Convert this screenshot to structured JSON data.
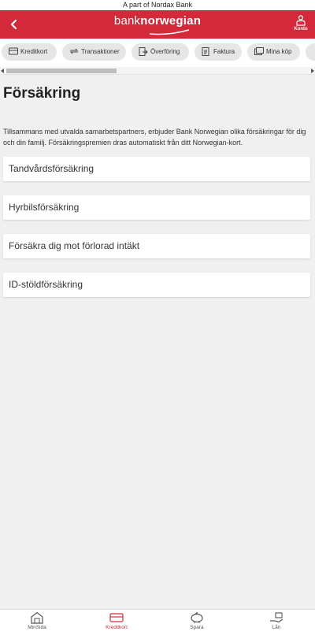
{
  "topbar": {
    "text": "A part of Nordax Bank"
  },
  "header": {
    "logo_light": "bank",
    "logo_bold": "norwegian",
    "account_label": "Konto"
  },
  "tabs": [
    {
      "label": "Kreditkort"
    },
    {
      "label": "Transaktioner"
    },
    {
      "label": "Överföring"
    },
    {
      "label": "Faktura"
    },
    {
      "label": "Mina köp"
    }
  ],
  "page": {
    "title": "Försäkring",
    "intro": "Tillsammans med utvalda samarbetspartners, erbjuder Bank Norwegian olika försäkringar för dig och din familj.  Försäkringspremien dras automatiskt från ditt Norwegian-kort."
  },
  "insurances": [
    {
      "label": "Tandvårdsförsäkring"
    },
    {
      "label": "Hyrbilsförsäkring"
    },
    {
      "label": "Försäkra dig mot förlorad intäkt"
    },
    {
      "label": "ID-stöldförsäkring"
    }
  ],
  "bottom_nav": [
    {
      "label": "MinSida",
      "icon": "home-icon"
    },
    {
      "label": "Kreditkort",
      "icon": "credit-card-icon",
      "active": true
    },
    {
      "label": "Spara",
      "icon": "piggy-bank-icon"
    },
    {
      "label": "Lån",
      "icon": "loan-hand-icon"
    }
  ],
  "colors": {
    "brand_red": "#d3293a",
    "background": "#f0f0f0"
  }
}
